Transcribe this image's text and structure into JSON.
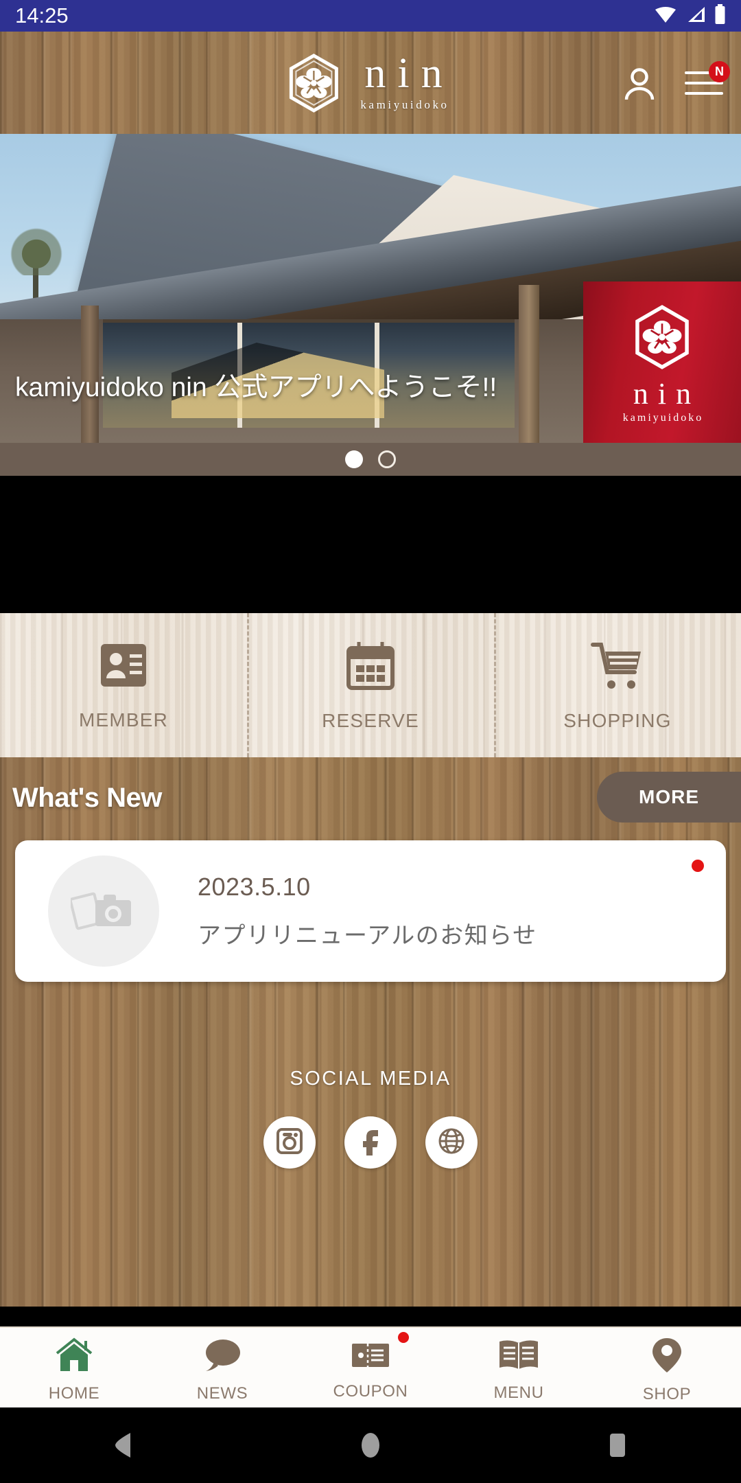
{
  "statusbar": {
    "time": "14:25",
    "icons": [
      "wifi-icon",
      "cellular-signal-icon",
      "battery-icon"
    ]
  },
  "header": {
    "logo_name": "nin",
    "logo_subtitle": "kamiyuidoko",
    "logo_crest": "hexagon-flower-crest-icon",
    "account_icon": "person-icon",
    "menu_icon": "hamburger-menu-icon",
    "menu_badge": "N"
  },
  "hero": {
    "caption": "kamiyuidoko nin 公式アプリへようこそ!!",
    "banner_logo_name": "nin",
    "banner_logo_subtitle": "kamiyuidoko",
    "slide_count": 2,
    "active_slide": 1,
    "photo_description": "Japanese-style salon building exterior with tiled roof and red nin banner"
  },
  "quick_actions": [
    {
      "label": "MEMBER",
      "icon": "id-card-icon"
    },
    {
      "label": "RESERVE",
      "icon": "calendar-icon"
    },
    {
      "label": "SHOPPING",
      "icon": "shopping-cart-icon"
    }
  ],
  "whats_new": {
    "title": "What's New",
    "more_label": "MORE",
    "items": [
      {
        "date": "2023.5.10",
        "title": "アプリリニューアルのお知らせ",
        "thumb_icon": "photo-camera-placeholder-icon",
        "unread": true
      }
    ]
  },
  "social": {
    "title": "SOCIAL MEDIA",
    "links": [
      {
        "name": "instagram-icon"
      },
      {
        "name": "facebook-icon"
      },
      {
        "name": "website-globe-icon"
      }
    ]
  },
  "tabbar": {
    "items": [
      {
        "label": "HOME",
        "icon": "house-icon",
        "active": true,
        "badge": false
      },
      {
        "label": "NEWS",
        "icon": "speech-bubble-icon",
        "active": false,
        "badge": false
      },
      {
        "label": "COUPON",
        "icon": "ticket-icon",
        "active": false,
        "badge": true
      },
      {
        "label": "MENU",
        "icon": "open-book-icon",
        "active": false,
        "badge": false
      },
      {
        "label": "SHOP",
        "icon": "map-pin-icon",
        "active": false,
        "badge": false
      }
    ]
  },
  "android_nav": {
    "back": "back-triangle-icon",
    "home": "home-circle-icon",
    "recents": "recents-square-icon"
  },
  "colors": {
    "statusbar": "#2e3192",
    "wood_dark": "#9b7b55",
    "wood_light": "#efe7dd",
    "accent_brown": "#6b5c52",
    "badge_red": "#d4101a",
    "active_green": "#3f8456",
    "icon_brown": "#8b7a6d"
  }
}
